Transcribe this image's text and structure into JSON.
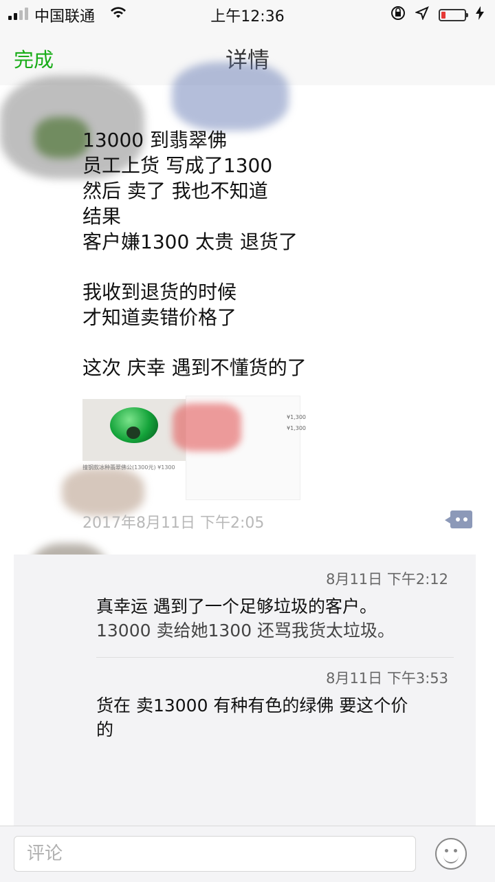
{
  "status_bar": {
    "carrier": "中国联通",
    "time": "上午12:36"
  },
  "nav": {
    "done_label": "完成",
    "title": "详情"
  },
  "post": {
    "lines": [
      "13000 到翡翠佛",
      "员工上货 写成了1300",
      "然后 卖了 我也不知道",
      "结果",
      "客户嫌1300 太贵 退货了",
      "",
      "我收到退货的时候",
      "才知道卖错价格了",
      "",
      "这次 庆幸 遇到不懂货的了"
    ],
    "image_caption": "撞钢款冰种翡翠佛公(1300元) ¥1300",
    "panel_text_1": "¥1,300",
    "panel_text_2": "¥1,300",
    "timestamp": "2017年8月11日 下午2:05"
  },
  "comments": [
    {
      "time": "8月11日 下午2:12",
      "text_lines": [
        "真幸运 遇到了一个足够垃圾的客户。",
        "13000 卖给她1300 还骂我货太垃圾。"
      ]
    },
    {
      "time": "8月11日 下午3:53",
      "text_lines": [
        "货在 卖13000 有种有色的绿佛 要这个价",
        "的"
      ]
    }
  ],
  "input": {
    "placeholder": "评论"
  },
  "colors": {
    "accent": "#1aad19",
    "comment_bg": "#f3f3f5",
    "link_blue": "#8c99b8"
  },
  "icons": [
    "signal-icon",
    "wifi-icon",
    "lock-rotation-icon",
    "location-icon",
    "battery-icon",
    "charging-icon",
    "comment-icon",
    "emoji-icon"
  ]
}
